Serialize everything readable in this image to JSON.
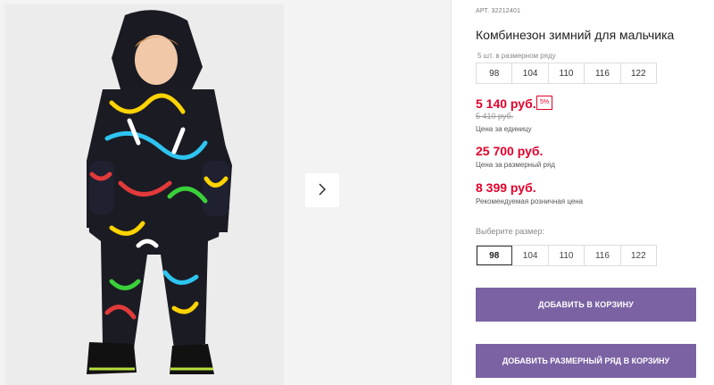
{
  "product": {
    "sku_label": "АРТ.",
    "sku_value": "32212401",
    "title": "Комбинезон зимний для мальчика",
    "series_note": "5 шт. в размерном ряду",
    "series_sizes": [
      "98",
      "104",
      "110",
      "116",
      "122"
    ]
  },
  "prices": {
    "current": "5 140 руб.",
    "discount_badge": "5%",
    "old": "5 410 руб.",
    "unit_caption": "Цена за единицу",
    "series_price": "25 700 руб.",
    "series_caption": "Цена за размерный ряд",
    "retail_price": "8 399 руб.",
    "retail_caption": "Рекомендуемая розничная цена"
  },
  "size_picker": {
    "label": "Выберите размер:",
    "options": [
      "98",
      "104",
      "110",
      "116",
      "122"
    ],
    "selected": "98"
  },
  "actions": {
    "add_to_cart": "ДОБАВИТЬ В КОРЗИНУ",
    "add_series_to_cart": "ДОБАВИТЬ РАЗМЕРНЫЙ РЯД В КОРЗИНУ"
  },
  "gallery": {
    "next_icon": "chevron-right-icon"
  },
  "colors": {
    "price_red": "#e3002b",
    "button_purple": "#7b62a3"
  }
}
